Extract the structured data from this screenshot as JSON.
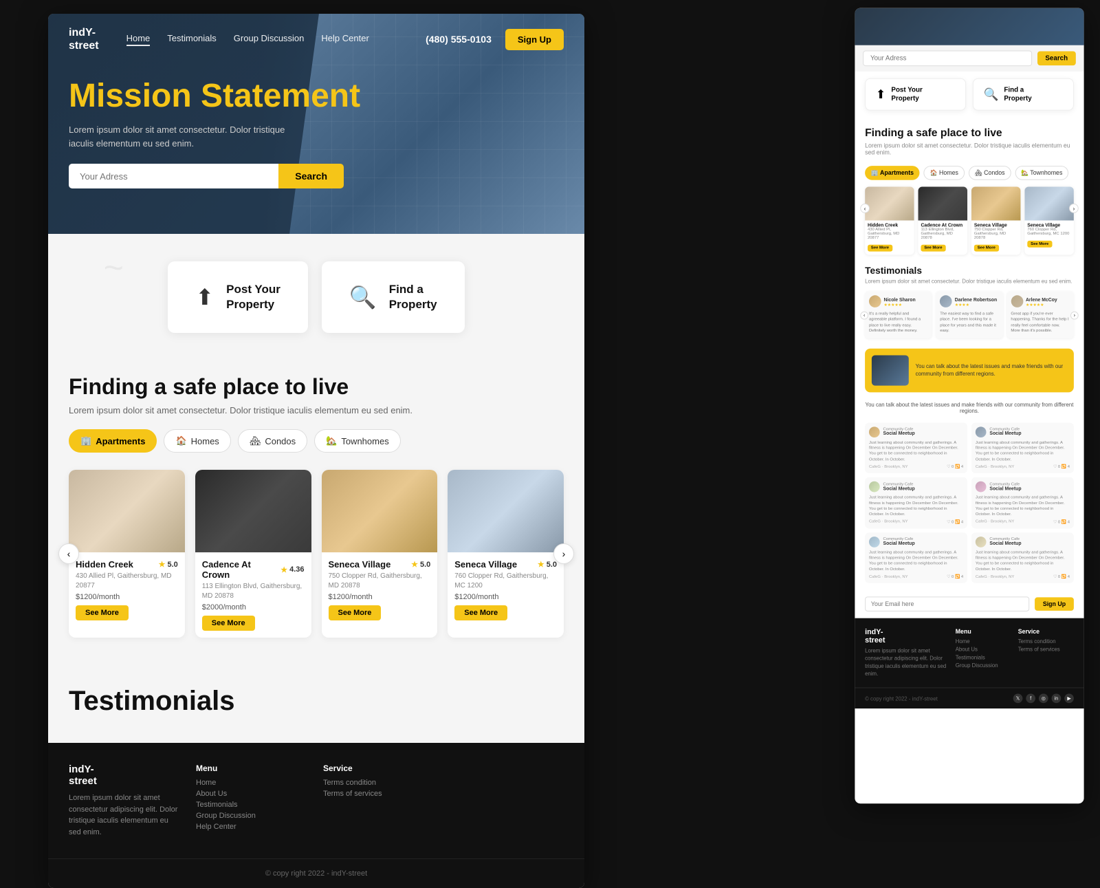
{
  "brand": {
    "name": "indY-\nstreet",
    "phone": "(480) 555-0103"
  },
  "nav": {
    "links": [
      "Home",
      "Testimonials",
      "Group Discussion",
      "Help Center"
    ],
    "active": "Home",
    "signup_label": "Sign Up"
  },
  "hero": {
    "title": "Mission Statement",
    "subtitle": "Lorem ipsum dolor sit amet consectetur. Dolor tristique iaculis elementum eu sed enim.",
    "search_placeholder": "Your Adress",
    "search_btn": "Search"
  },
  "actions": {
    "post_property": "Post Your\nProperty",
    "find_property": "Find a\nProperty"
  },
  "safe_section": {
    "title": "Finding a safe place to live",
    "subtitle": "Lorem ipsum dolor sit amet consectetur. Dolor tristique iaculis elementum eu sed enim."
  },
  "filter_tabs": [
    {
      "label": "Apartments",
      "active": true
    },
    {
      "label": "Homes",
      "active": false
    },
    {
      "label": "Condos",
      "active": false
    },
    {
      "label": "Townhomes",
      "active": false
    }
  ],
  "listings": [
    {
      "name": "Hidden Creek",
      "rating": "5.0",
      "address": "430 Allied Pl, Gaithersburg, MD 20877",
      "price": "$1200/month",
      "img_class": "img-hidden-creek"
    },
    {
      "name": "Cadence At Crown",
      "rating": "4.36",
      "address": "113 Ellington Blvd, Gaithersburg, MD 20878",
      "price": "$2000/month",
      "img_class": "img-cadence"
    },
    {
      "name": "Seneca Village",
      "rating": "5.0",
      "address": "750 Clopper Rd, Gaithersburg, MD 20878",
      "price": "$1200/month",
      "img_class": "img-seneca1"
    },
    {
      "name": "Seneca Village",
      "rating": "5.0",
      "address": "760 Clopper Rd, Gaithersburg, MC 1200",
      "price": "$1200/month",
      "img_class": "img-seneca2"
    }
  ],
  "see_more_label": "See More",
  "testimonials": {
    "title": "Testimonials",
    "subtitle": "Lorem ipsum dolor sit amet consectetur. Dolor tristique iaculis elementum eu sed enim.",
    "items": [
      {
        "name": "Nicole Sharon",
        "stars": "★★★★★",
        "text": "It's a really helpful and agreeable platform. I found a place to live really easy. Definitely worth the money."
      },
      {
        "name": "Darlene Robertson",
        "stars": "★★★★",
        "text": "The easiest way to find a safe place. I've been looking for a place for years and this made it easy."
      },
      {
        "name": "Arlene McCoy",
        "stars": "★★★★★",
        "text": "Great app if you're ever happening. Thanks for the help I really feel comfortable now. More than it's possible."
      }
    ]
  },
  "cta_banner": {
    "text": "You can talk about the latest issues and make friends with our community from different regions."
  },
  "community": {
    "subtitle": "You can talk about the latest issues and make friends with our community from different regions.",
    "type": "Community Cafe",
    "post_title": "Social Meetup",
    "post_text": "Just learning about community and gatherings. A fitness is happening On December On December. You get to be connected to neighborhood in October. In October."
  },
  "email_signup": {
    "placeholder": "Your Email here",
    "btn_label": "Sign Up"
  },
  "footer": {
    "logo": "indY-\nstreet",
    "description": "Lorem ipsum dolor sit amet consectetur adipiscing elit. Dolor tristique iaculis elementum eu sed enim.",
    "menu_col": {
      "title": "Menu",
      "links": [
        "Home",
        "About Us",
        "Testimonials",
        "Group Discussion",
        "Help Center"
      ]
    },
    "service_col": {
      "title": "Service",
      "links": [
        "Terms condition",
        "Terms of services"
      ]
    },
    "copyright": "© copy right 2022 - indY-street"
  }
}
